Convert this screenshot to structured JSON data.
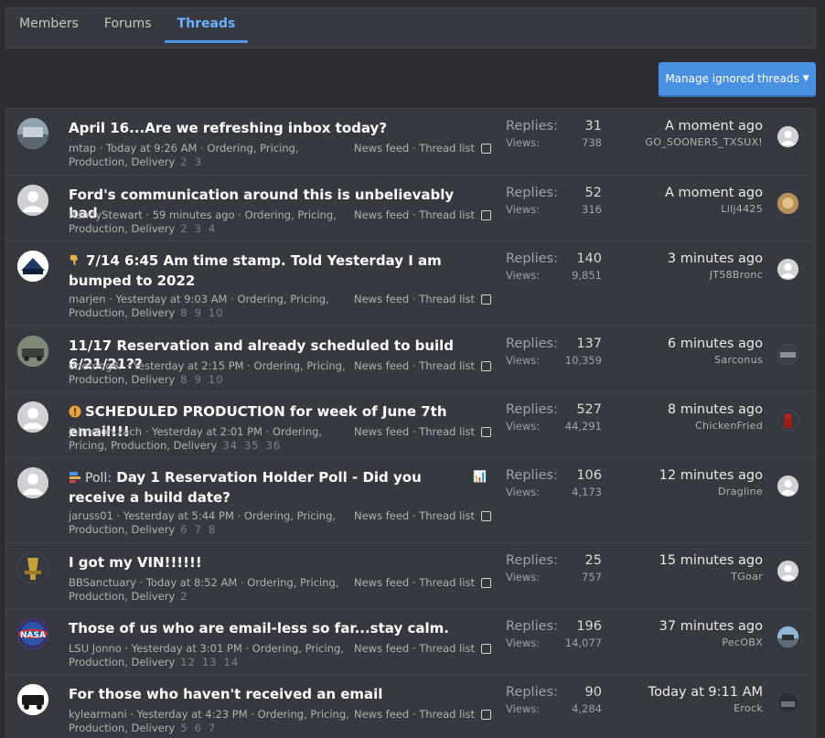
{
  "tabs": [
    {
      "label": "Members",
      "active": false
    },
    {
      "label": "Forums",
      "active": false
    },
    {
      "label": "Threads",
      "active": true
    }
  ],
  "manage_button": {
    "label": "Manage ignored threads"
  },
  "labels": {
    "replies": "Replies:",
    "views": "Views:",
    "news_feed": "News feed",
    "separator": "·",
    "thread_list": "Thread list"
  },
  "threads": [
    {
      "title": "April 16...Are we refreshing inbox today?",
      "prefix": "",
      "icon": "",
      "author": "mtap",
      "date": "Today at 9:26 AM",
      "forum": "Ordering, Pricing, Production, Delivery",
      "pages": [
        "2",
        "3"
      ],
      "replies": "31",
      "views": "738",
      "last_time": "A moment ago",
      "last_user": "GO_SOONERS_TXSUX!"
    },
    {
      "title": "Ford's communication around this is unbelievably bad",
      "prefix": "",
      "icon": "",
      "author": "RandyStewart",
      "date": "59 minutes ago",
      "forum": "Ordering, Pricing, Production, Delivery",
      "pages": [
        "2",
        "3",
        "4"
      ],
      "replies": "52",
      "views": "316",
      "last_time": "A moment ago",
      "last_user": "Lilj4425"
    },
    {
      "title": "7/14 6:45 Am time stamp. Told Yesterday I am bumped to 2022",
      "prefix": "",
      "icon": "thumbs-down",
      "author": "marjen",
      "date": "Yesterday at 9:03 AM",
      "forum": "Ordering, Pricing, Production, Delivery",
      "pages": [
        "8",
        "9",
        "10"
      ],
      "replies": "140",
      "views": "9,851",
      "last_time": "3 minutes ago",
      "last_user": "JT58Bronc"
    },
    {
      "title": "11/17 Reservation and already scheduled to build 6/21/21??",
      "prefix": "",
      "icon": "",
      "author": "onetong8r",
      "date": "Yesterday at 2:15 PM",
      "forum": "Ordering, Pricing, Production, Delivery",
      "pages": [
        "8",
        "9",
        "10"
      ],
      "replies": "137",
      "views": "10,359",
      "last_time": "6 minutes ago",
      "last_user": "Sarconus"
    },
    {
      "title": "SCHEDULED PRODUCTION for week of June 7th email!!!",
      "prefix": "",
      "icon": "exclamation",
      "author": "johnston.zach",
      "date": "Yesterday at 2:01 PM",
      "forum": "Ordering, Pricing, Production, Delivery",
      "pages": [
        "34",
        "35",
        "36"
      ],
      "replies": "527",
      "views": "44,291",
      "last_time": "8 minutes ago",
      "last_user": "ChickenFried"
    },
    {
      "title": "Day 1 Reservation Holder Poll - Did you receive a build date?",
      "prefix": "Poll:",
      "icon": "chart",
      "author": "jaruss01",
      "date": "Yesterday at 5:44 PM",
      "forum": "Ordering, Pricing, Production, Delivery",
      "pages": [
        "6",
        "7",
        "8"
      ],
      "replies": "106",
      "views": "4,173",
      "last_time": "12 minutes ago",
      "last_user": "Dragline"
    },
    {
      "title": "I got my VIN!!!!!!",
      "prefix": "",
      "icon": "",
      "author": "BBSanctuary",
      "date": "Today at 8:52 AM",
      "forum": "Ordering, Pricing, Production, Delivery",
      "pages": [
        "2"
      ],
      "replies": "25",
      "views": "757",
      "last_time": "15 minutes ago",
      "last_user": "TGoar"
    },
    {
      "title": "Those of us who are email-less so far...stay calm.",
      "prefix": "",
      "icon": "",
      "author": "LSU Jonno",
      "date": "Yesterday at 3:01 PM",
      "forum": "Ordering, Pricing, Production, Delivery",
      "pages": [
        "12",
        "13",
        "14"
      ],
      "replies": "196",
      "views": "14,077",
      "last_time": "37 minutes ago",
      "last_user": "PecOBX"
    },
    {
      "title": "For those who haven't received an email",
      "prefix": "",
      "icon": "",
      "author": "kylearmani",
      "date": "Yesterday at 4:23 PM",
      "forum": "Ordering, Pricing, Production, Delivery",
      "pages": [
        "5",
        "6",
        "7"
      ],
      "replies": "90",
      "views": "4,284",
      "last_time": "Today at 9:11 AM",
      "last_user": "Erock"
    }
  ],
  "colors": {
    "background": "#2c2e33",
    "panel": "#36393f",
    "accent": "#4a90e2",
    "active_tab": "#6cb0ff"
  }
}
